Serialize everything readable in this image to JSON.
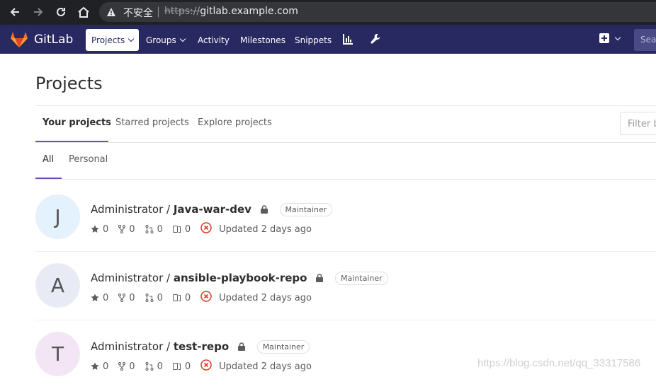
{
  "browser": {
    "insecure_label": "不安全",
    "url_scheme": "https://",
    "url_host": "gitlab.example.com"
  },
  "navbar": {
    "brand": "GitLab",
    "items": [
      {
        "label": "Projects"
      },
      {
        "label": "Groups"
      },
      {
        "label": "Activity"
      },
      {
        "label": "Milestones"
      },
      {
        "label": "Snippets"
      }
    ],
    "search_placeholder": "Search"
  },
  "page": {
    "title": "Projects",
    "tabs": [
      {
        "label": "Your projects"
      },
      {
        "label": "Starred projects"
      },
      {
        "label": "Explore projects"
      }
    ],
    "filter_placeholder": "Filter by name",
    "subtabs": [
      {
        "label": "All"
      },
      {
        "label": "Personal"
      }
    ]
  },
  "projects": [
    {
      "avatar_letter": "J",
      "avatar_color": "#e3f2fd",
      "namespace": "Administrator / ",
      "name": "Java-war-dev",
      "role": "Maintainer",
      "stars": "0",
      "forks": "0",
      "merge_requests": "0",
      "issues": "0",
      "updated": "Updated 2 days ago"
    },
    {
      "avatar_letter": "A",
      "avatar_color": "#e8eaf6",
      "namespace": "Administrator / ",
      "name": "ansible-playbook-repo",
      "role": "Maintainer",
      "stars": "0",
      "forks": "0",
      "merge_requests": "0",
      "issues": "0",
      "updated": "Updated 2 days ago"
    },
    {
      "avatar_letter": "T",
      "avatar_color": "#f3e5f5",
      "namespace": "Administrator / ",
      "name": "test-repo",
      "role": "Maintainer",
      "stars": "0",
      "forks": "0",
      "merge_requests": "0",
      "issues": "0",
      "updated": "Updated 2 days ago"
    }
  ],
  "watermark": "https://blog.csdn.net/qq_33317586",
  "colors": {
    "navbar": "#292961",
    "accent": "#6b4fbb",
    "pipeline_failed": "#db3b21"
  }
}
